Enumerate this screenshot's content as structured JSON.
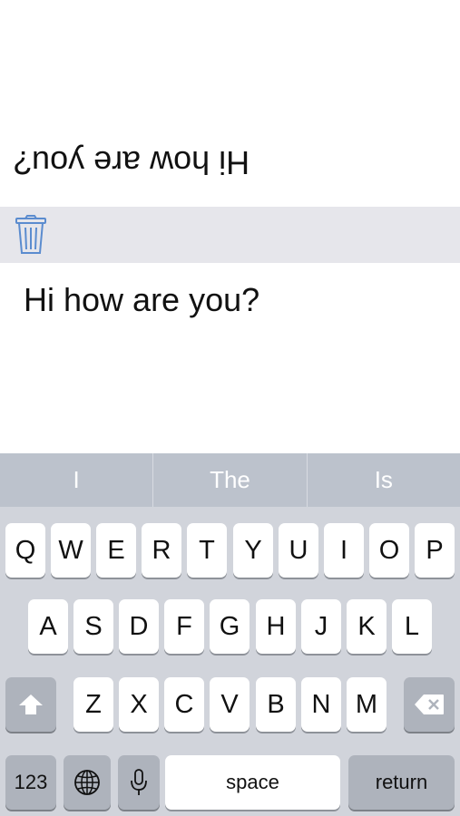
{
  "display": {
    "flipped_text": "Hi how are you?"
  },
  "input": {
    "text": "Hi how are you?"
  },
  "toolbar": {
    "trash_icon": "trash-icon"
  },
  "keyboard": {
    "suggestions": [
      "I",
      "The",
      "Is"
    ],
    "row1": [
      "Q",
      "W",
      "E",
      "R",
      "T",
      "Y",
      "U",
      "I",
      "O",
      "P"
    ],
    "row2": [
      "A",
      "S",
      "D",
      "F",
      "G",
      "H",
      "J",
      "K",
      "L"
    ],
    "row3": [
      "Z",
      "X",
      "C",
      "V",
      "B",
      "N",
      "M"
    ],
    "numbers_label": "123",
    "space_label": "space",
    "return_label": "return",
    "shift_icon": "shift-arrow-icon",
    "globe_icon": "globe-icon",
    "mic_icon": "microphone-icon",
    "delete_icon": "backspace-icon"
  },
  "colors": {
    "keyboard_bg": "#d1d4db",
    "suggestion_bar": "#bcc2cc",
    "toolbar_bg": "#e6e6eb",
    "dark_key": "#aeb3bc",
    "icon_blue": "#5b8ccf"
  }
}
